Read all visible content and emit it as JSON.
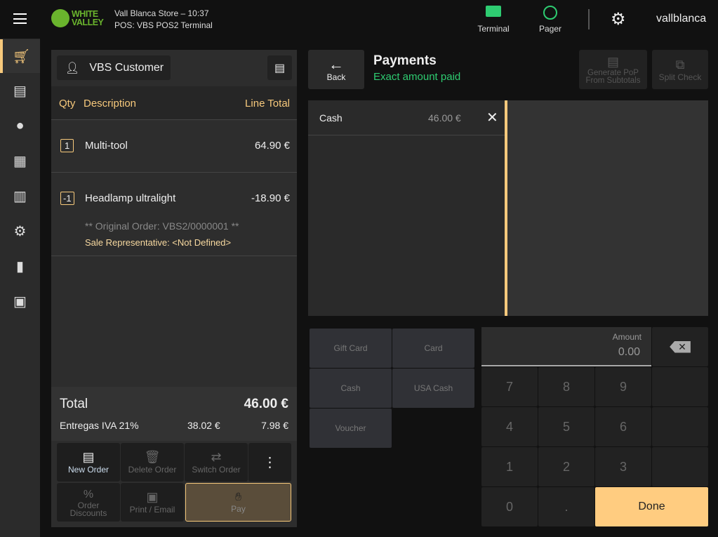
{
  "header": {
    "store_line": "Vall Blanca Store – 10:37",
    "pos_line": "POS: VBS POS2 Terminal",
    "logo_text": "WHITE VALLEY",
    "terminal_label": "Terminal",
    "pager_label": "Pager",
    "user": "vallblanca"
  },
  "order": {
    "customer": "VBS Customer",
    "col_qty": "Qty",
    "col_desc": "Description",
    "col_total": "Line Total",
    "lines": [
      {
        "qty": "1",
        "desc": "Multi-tool",
        "total": "64.90 €"
      },
      {
        "qty": "-1",
        "desc": "Headlamp ultralight",
        "total": "-18.90 €",
        "note": "** Original Order: VBS2/0000001 **",
        "rep": "Sale Representative: <Not Defined>"
      }
    ],
    "total_label": "Total",
    "total_value": "46.00 €",
    "tax_label": "Entregas IVA 21%",
    "tax_base": "38.02 €",
    "tax_amount": "7.98 €",
    "actions": {
      "new_order": "New Order",
      "delete_order": "Delete Order",
      "switch_order": "Switch Order",
      "order_discounts": "Order Discounts",
      "print_email": "Print / Email",
      "pay": "Pay"
    }
  },
  "payments": {
    "back": "Back",
    "title": "Payments",
    "status": "Exact amount paid",
    "generate_pop": "Generate PoP From Subtotals",
    "split_check": "Split Check",
    "list": [
      {
        "method": "Cash",
        "amount": "46.00 €"
      }
    ],
    "methods": [
      "Gift Card",
      "Card",
      "Cash",
      "USA Cash",
      "Voucher"
    ],
    "amount_label": "Amount",
    "amount_value": "0.00",
    "keys": [
      "7",
      "8",
      "9",
      "4",
      "5",
      "6",
      "1",
      "2",
      "3",
      "0",
      "."
    ],
    "done": "Done"
  },
  "colors": {
    "accent": "#f7c97c",
    "green": "#2ecc71",
    "logo_green": "#6ab42d"
  }
}
